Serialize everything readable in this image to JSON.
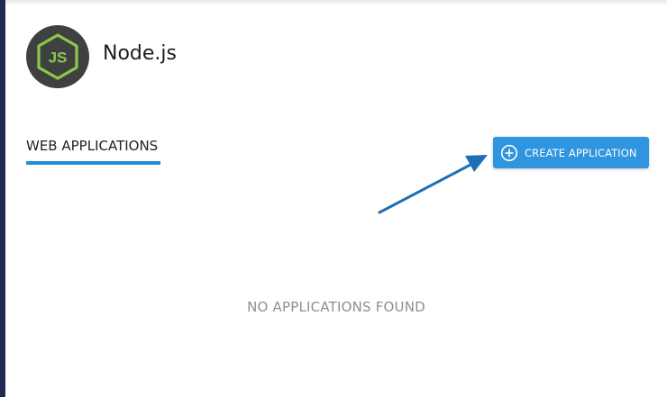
{
  "app": {
    "title": "Node.js",
    "logo_icon": "nodejs-hexagon-icon",
    "logo_text": "JS"
  },
  "tabs": [
    {
      "label": "WEB APPLICATIONS",
      "active": true
    }
  ],
  "actions": {
    "create_label": "CREATE APPLICATION",
    "create_icon": "plus-circle-icon"
  },
  "empty_state": {
    "message": "NO APPLICATIONS FOUND"
  },
  "annotation": {
    "type": "arrow-icon",
    "points_to": "create-application-button",
    "color": "#1f6fb8"
  },
  "colors": {
    "accent": "#2e95de",
    "tab_underline": "#1e8fdd",
    "logo_bg": "#3f4141",
    "logo_green": "#8cc84b",
    "sidebar": "#1f2a52"
  }
}
